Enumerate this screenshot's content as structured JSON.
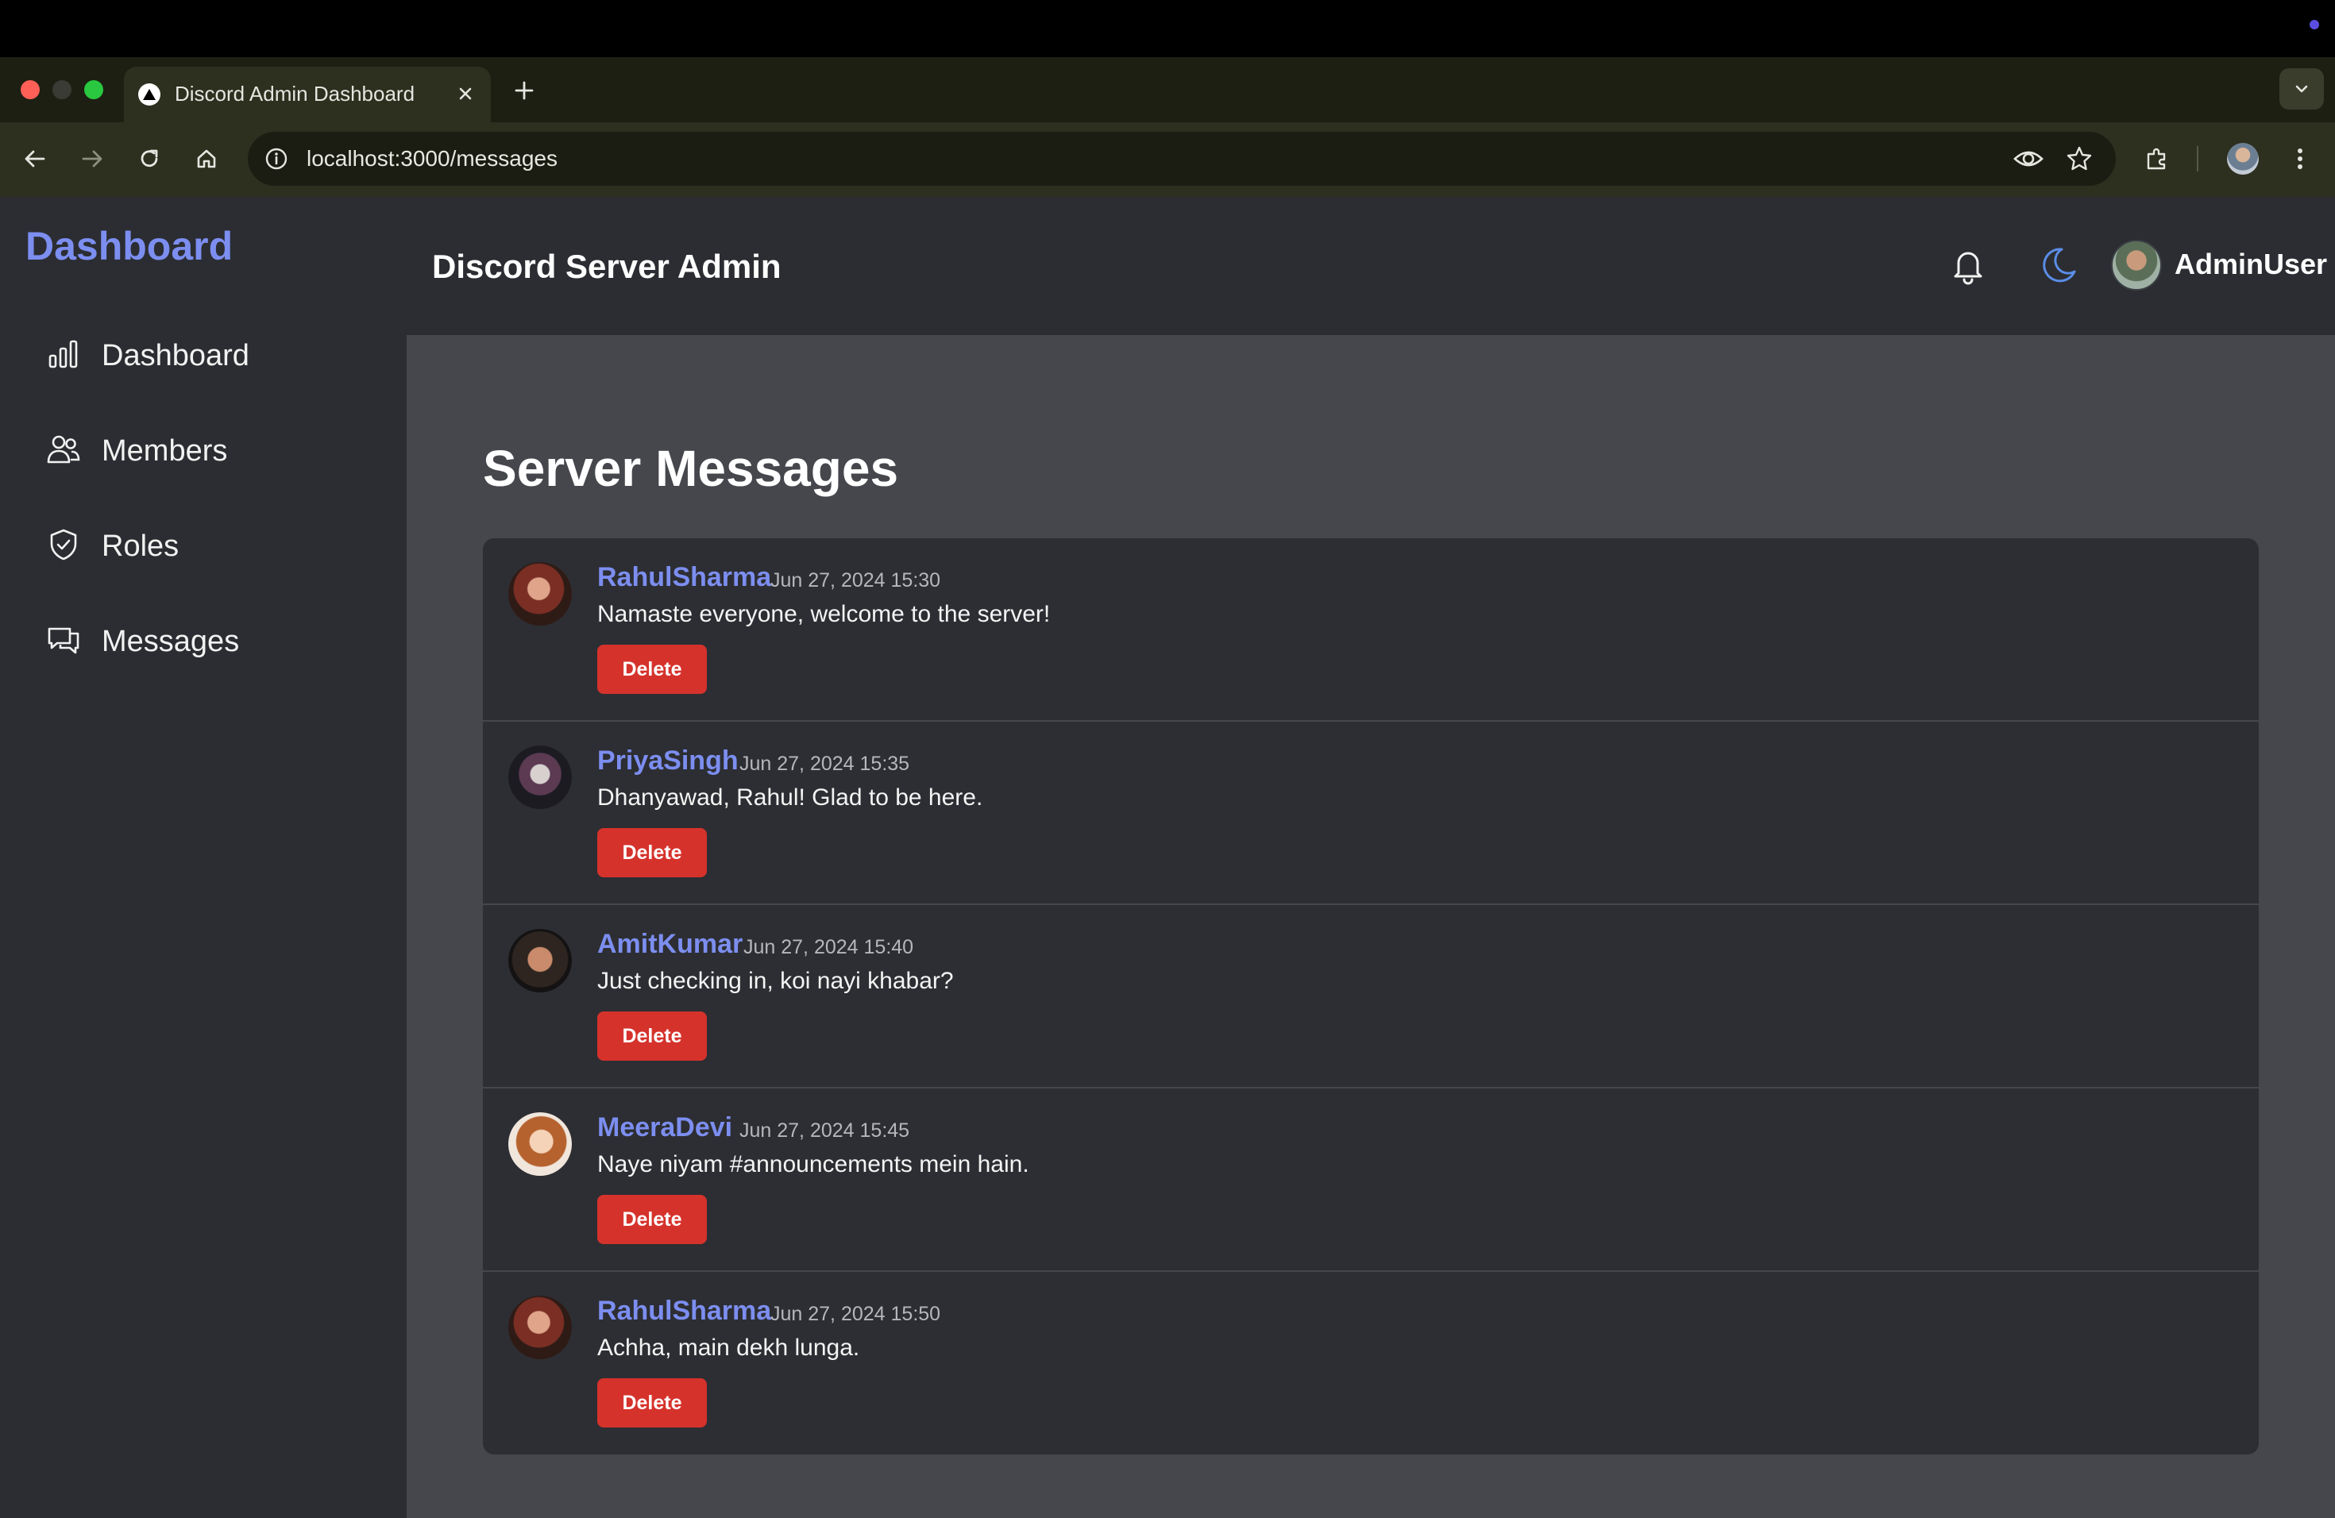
{
  "browser": {
    "tab_title": "Discord Admin Dashboard",
    "url": "localhost:3000/messages"
  },
  "sidebar": {
    "brand": "Dashboard",
    "items": [
      {
        "label": "Dashboard",
        "icon": "bar-chart-icon"
      },
      {
        "label": "Members",
        "icon": "users-icon"
      },
      {
        "label": "Roles",
        "icon": "shield-icon"
      },
      {
        "label": "Messages",
        "icon": "chat-icon"
      }
    ]
  },
  "header": {
    "title": "Discord Server Admin",
    "user_name": "AdminUser"
  },
  "main": {
    "page_title": "Server Messages",
    "delete_label": "Delete",
    "messages": [
      {
        "user": "RahulSharma",
        "time": "Jun 27, 2024 15:30",
        "text": "Namaste everyone, welcome to the server!"
      },
      {
        "user": "PriyaSingh",
        "time": "Jun 27, 2024 15:35",
        "text": "Dhanyawad, Rahul! Glad to be here."
      },
      {
        "user": "AmitKumar",
        "time": "Jun 27, 2024 15:40",
        "text": "Just checking in, koi nayi khabar?"
      },
      {
        "user": "MeeraDevi",
        "time": "Jun 27, 2024 15:45",
        "text": "Naye niyam #announcements mein hain."
      },
      {
        "user": "RahulSharma",
        "time": "Jun 27, 2024 15:50",
        "text": "Achha, main dekh lunga."
      }
    ]
  },
  "colors": {
    "accent": "#7c8ef0",
    "danger": "#d6322c",
    "sidebar_bg": "#2b2d32",
    "main_bg": "#45474c",
    "card_bg": "#2d2e33"
  }
}
